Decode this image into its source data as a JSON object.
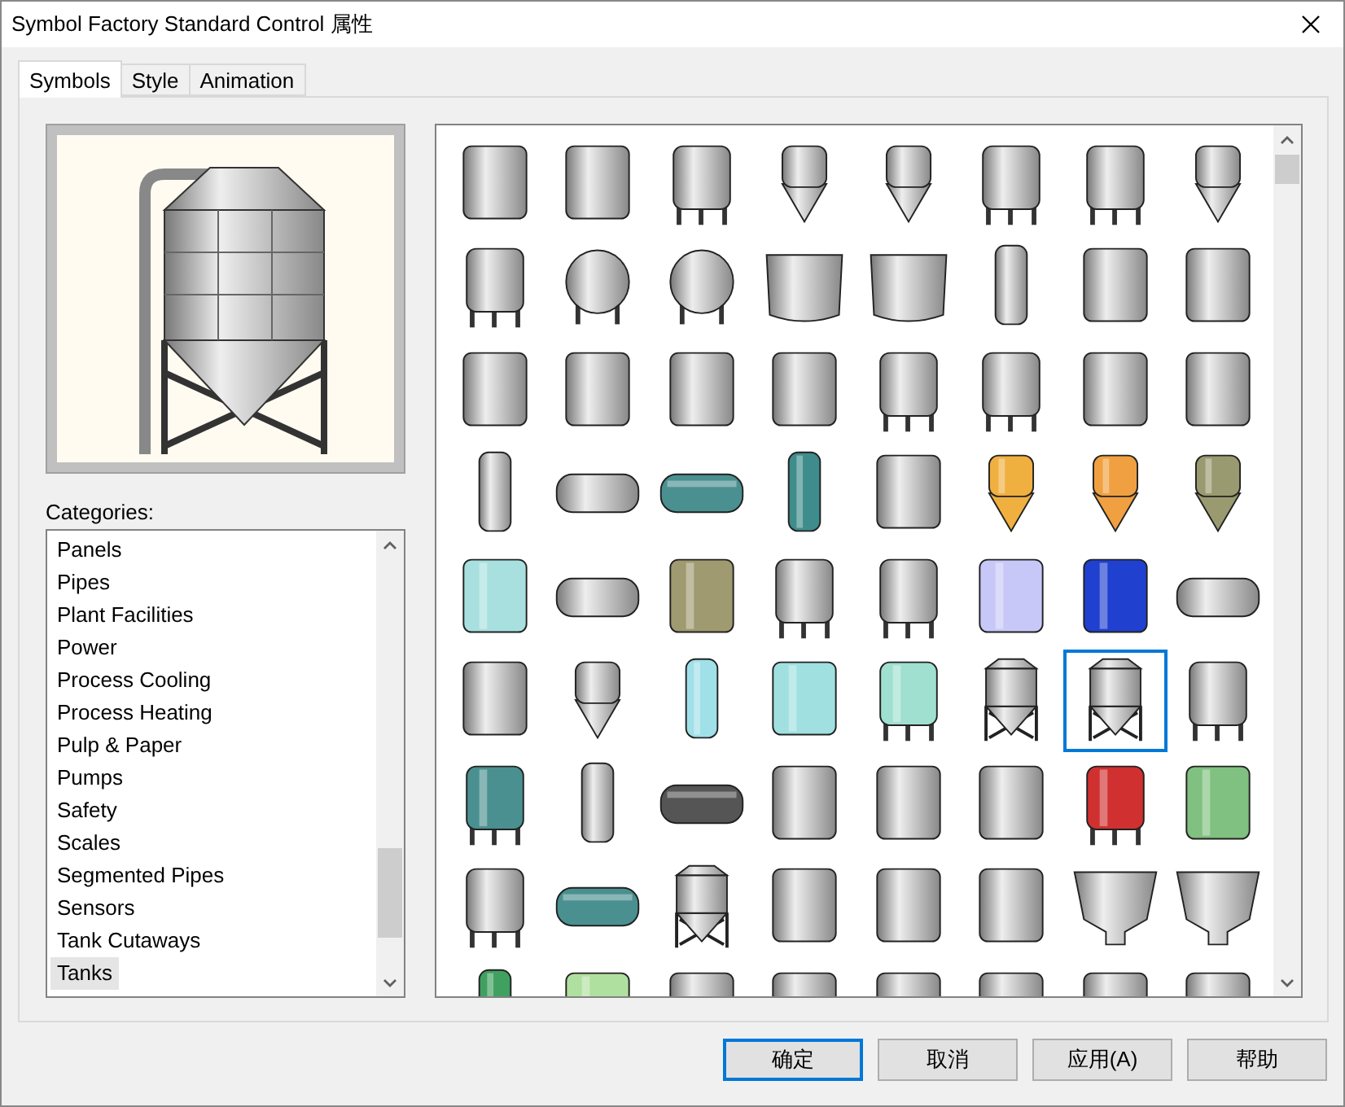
{
  "window": {
    "title": "Symbol Factory Standard Control 属性"
  },
  "tabs": [
    {
      "label": "Symbols",
      "selected": true
    },
    {
      "label": "Style",
      "selected": false
    },
    {
      "label": "Animation",
      "selected": false
    }
  ],
  "categories_label": "Categories:",
  "categories": [
    {
      "label": "Panels",
      "selected": false
    },
    {
      "label": "Pipes",
      "selected": false
    },
    {
      "label": "Plant Facilities",
      "selected": false
    },
    {
      "label": "Power",
      "selected": false
    },
    {
      "label": "Process Cooling",
      "selected": false
    },
    {
      "label": "Process Heating",
      "selected": false
    },
    {
      "label": "Pulp & Paper",
      "selected": false
    },
    {
      "label": "Pumps",
      "selected": false
    },
    {
      "label": "Safety",
      "selected": false
    },
    {
      "label": "Scales",
      "selected": false
    },
    {
      "label": "Segmented Pipes",
      "selected": false
    },
    {
      "label": "Sensors",
      "selected": false
    },
    {
      "label": "Tank Cutaways",
      "selected": false
    },
    {
      "label": "Tanks",
      "selected": true
    }
  ],
  "symbols": [
    {
      "kind": "drum",
      "selected": false
    },
    {
      "kind": "drum",
      "selected": false
    },
    {
      "kind": "legs",
      "selected": false
    },
    {
      "kind": "cone",
      "selected": false
    },
    {
      "kind": "cone",
      "selected": false
    },
    {
      "kind": "legs",
      "selected": false
    },
    {
      "kind": "legs",
      "selected": false
    },
    {
      "kind": "cone",
      "selected": false
    },
    {
      "kind": "legs",
      "selected": false
    },
    {
      "kind": "sphere",
      "selected": false
    },
    {
      "kind": "sphere",
      "selected": false
    },
    {
      "kind": "open",
      "selected": false
    },
    {
      "kind": "open",
      "selected": false
    },
    {
      "kind": "narrow",
      "selected": false
    },
    {
      "kind": "drum",
      "selected": false
    },
    {
      "kind": "drum",
      "selected": false
    },
    {
      "kind": "drum",
      "selected": false
    },
    {
      "kind": "drum",
      "selected": false
    },
    {
      "kind": "drum",
      "selected": false
    },
    {
      "kind": "drum",
      "selected": false
    },
    {
      "kind": "legs",
      "selected": false
    },
    {
      "kind": "legs",
      "selected": false
    },
    {
      "kind": "drum",
      "selected": false
    },
    {
      "kind": "drum",
      "selected": false
    },
    {
      "kind": "narrow",
      "selected": false
    },
    {
      "kind": "horizontal",
      "selected": false
    },
    {
      "kind": "horizontal",
      "selected": false,
      "color": "#4a9090"
    },
    {
      "kind": "narrow",
      "selected": false,
      "color": "#3f8c8c"
    },
    {
      "kind": "drum",
      "selected": false
    },
    {
      "kind": "cone",
      "selected": false,
      "color": "#f0b040"
    },
    {
      "kind": "cone",
      "selected": false,
      "color": "#f0a040"
    },
    {
      "kind": "cone",
      "selected": false,
      "color": "#9a9a70"
    },
    {
      "kind": "drum",
      "selected": false,
      "color": "#a8e0e0"
    },
    {
      "kind": "horizontal",
      "selected": false
    },
    {
      "kind": "drum",
      "selected": false,
      "color": "#a09a70"
    },
    {
      "kind": "legs",
      "selected": false
    },
    {
      "kind": "legs",
      "selected": false
    },
    {
      "kind": "drum",
      "selected": false,
      "color": "#c8c8f8"
    },
    {
      "kind": "drum",
      "selected": false,
      "color": "#2040d0"
    },
    {
      "kind": "horizontal",
      "selected": false
    },
    {
      "kind": "drum",
      "selected": false
    },
    {
      "kind": "cone",
      "selected": false
    },
    {
      "kind": "narrow",
      "selected": false,
      "color": "#a0e0e8"
    },
    {
      "kind": "drum",
      "selected": false,
      "color": "#a0e0e0"
    },
    {
      "kind": "legs",
      "selected": false,
      "color": "#a0e0d0"
    },
    {
      "kind": "silo",
      "selected": false
    },
    {
      "kind": "silo",
      "selected": true
    },
    {
      "kind": "legs",
      "selected": false
    },
    {
      "kind": "legs",
      "selected": false,
      "color": "#4a9090"
    },
    {
      "kind": "narrow",
      "selected": false
    },
    {
      "kind": "horizontal",
      "selected": false,
      "color": "#555555"
    },
    {
      "kind": "drum",
      "selected": false
    },
    {
      "kind": "drum",
      "selected": false
    },
    {
      "kind": "drum",
      "selected": false
    },
    {
      "kind": "legs",
      "selected": false,
      "color": "#d03030"
    },
    {
      "kind": "drum",
      "selected": false,
      "color": "#80c080"
    },
    {
      "kind": "legs",
      "selected": false
    },
    {
      "kind": "horizontal",
      "selected": false,
      "color": "#4a9090"
    },
    {
      "kind": "silo",
      "selected": false
    },
    {
      "kind": "drum",
      "selected": false
    },
    {
      "kind": "drum",
      "selected": false
    },
    {
      "kind": "drum",
      "selected": false
    },
    {
      "kind": "hopper",
      "selected": false
    },
    {
      "kind": "hopper",
      "selected": false
    },
    {
      "kind": "narrow",
      "selected": false,
      "color": "#40a060"
    },
    {
      "kind": "drum",
      "selected": false,
      "color": "#b0e0a0"
    },
    {
      "kind": "drum",
      "selected": false
    },
    {
      "kind": "drum",
      "selected": false
    },
    {
      "kind": "drum",
      "selected": false
    },
    {
      "kind": "drum",
      "selected": false
    },
    {
      "kind": "drum",
      "selected": false
    },
    {
      "kind": "drum",
      "selected": false
    }
  ],
  "buttons": [
    {
      "label": "确定",
      "default": true
    },
    {
      "label": "取消",
      "default": false
    },
    {
      "label": "应用(A)",
      "default": false
    },
    {
      "label": "帮助",
      "default": false
    }
  ]
}
